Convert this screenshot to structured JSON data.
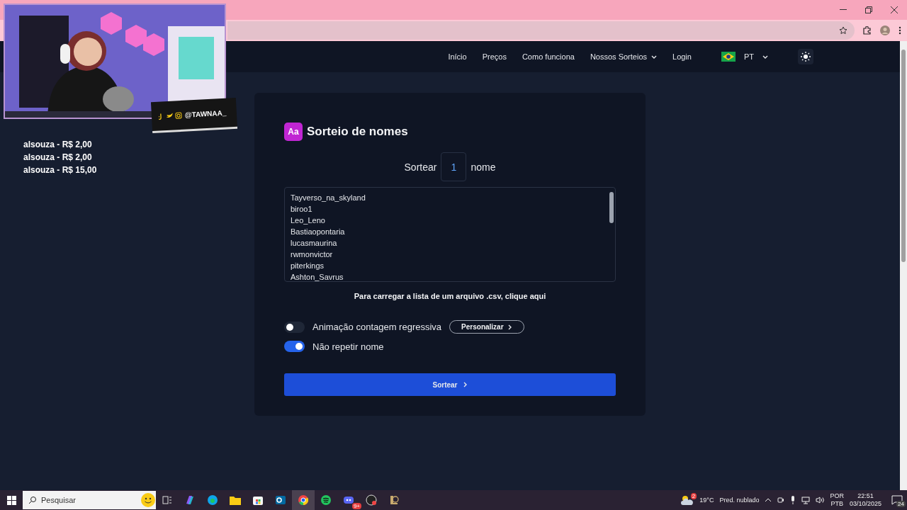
{
  "stream_overlay": {
    "social_handle": "@TAWNAA_",
    "donations": [
      "alsouza - R$ 2,00",
      "alsouza - R$ 2,00",
      "alsouza - R$ 15,00"
    ]
  },
  "nav": {
    "items": [
      {
        "label": "Início",
        "dropdown": false
      },
      {
        "label": "Preços",
        "dropdown": false
      },
      {
        "label": "Como funciona",
        "dropdown": false
      },
      {
        "label": "Nossos Sorteios",
        "dropdown": true
      },
      {
        "label": "Login",
        "dropdown": false
      }
    ],
    "language": "PT"
  },
  "card": {
    "badge": "Aa",
    "title": "Sorteio de nomes",
    "count_prefix": "Sortear",
    "count": "1",
    "count_suffix": "nome",
    "names": [
      "Tayverso_na_skyland",
      "biroo1",
      "Leo_Leno",
      "Bastiaopontaria",
      "lucasmaurina",
      "rwmonvictor",
      "piterkings",
      "Ashton_Savrus"
    ],
    "csv_hint": "Para carregar a lista de um arquivo .csv, clique aqui",
    "options": [
      {
        "label": "Animação contagem regressiva",
        "on": false,
        "button": "Personalizar"
      },
      {
        "label": "Não repetir nome",
        "on": true
      }
    ],
    "submit": "Sortear"
  },
  "taskbar": {
    "search_placeholder": "Pesquisar",
    "apps": [
      {
        "kind": "copilot",
        "selected": false
      },
      {
        "kind": "edge",
        "selected": false
      },
      {
        "kind": "files",
        "selected": false
      },
      {
        "kind": "store",
        "selected": false
      },
      {
        "kind": "outlook",
        "selected": false
      },
      {
        "kind": "chrome",
        "selected": true
      },
      {
        "kind": "spotify",
        "selected": false
      },
      {
        "kind": "discord",
        "selected": false,
        "badge": "9+"
      },
      {
        "kind": "obs",
        "selected": false
      },
      {
        "kind": "league",
        "selected": false
      }
    ],
    "weather": {
      "badge": "2",
      "temperature": "19°C",
      "condition": "Pred. nublado"
    },
    "input_language": "POR",
    "keyboard_layout": "PTB",
    "time": "22:51",
    "date": "03/10/2025",
    "notifications": "24"
  }
}
